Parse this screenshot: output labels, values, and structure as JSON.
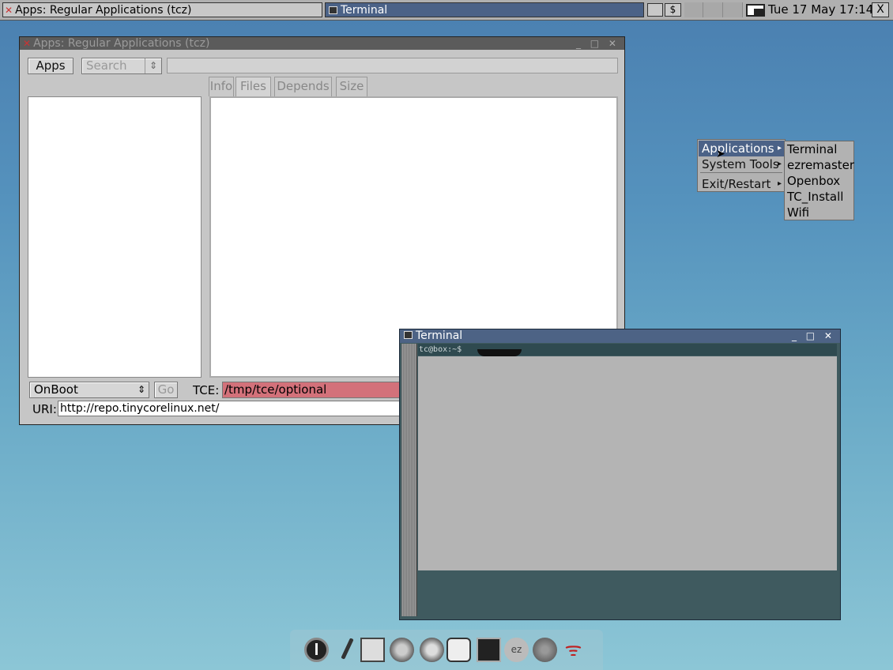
{
  "taskbar": {
    "apps_task": "Apps: Regular Applications (tcz)",
    "terminal_task": "Terminal",
    "tray_1": "",
    "tray_2": "$",
    "clock": "Tue 17 May 17:14",
    "close": "X"
  },
  "apps_window": {
    "title": "Apps: Regular Applications (tcz)",
    "controls": "_ □ ✕",
    "apps_button": "Apps",
    "search_select": "Search",
    "search_value": "",
    "tabs": [
      "Info",
      "Files",
      "Depends",
      "Size"
    ],
    "onboot_select": "OnBoot",
    "go_button": "Go",
    "tce_label": "TCE:",
    "tce_value": "/tmp/tce/optional",
    "uri_label": "URI:",
    "uri_value": "http://repo.tinycorelinux.net/"
  },
  "terminal_window": {
    "title": "Terminal",
    "controls": "_ □ ✕",
    "prompt": "tc@box:~$"
  },
  "menu": {
    "items": [
      {
        "label": "Applications"
      },
      {
        "label": "System Tools"
      },
      {
        "label": "Exit/Restart"
      }
    ],
    "submenu": [
      "Terminal",
      "ezremaster",
      "Openbox",
      "TC_Install",
      "Wifi"
    ]
  },
  "dock": {
    "icons": [
      "power-icon",
      "paintbrush-icon",
      "control-panel-icon",
      "apps-icon",
      "run-icon",
      "tce-load-icon",
      "terminal-icon",
      "ezremaster-icon",
      "cd-icon",
      "wifi-icon"
    ],
    "ezremaster_text": "ez"
  },
  "colors": {
    "active_title": "#4b6287",
    "tce_field": "#d3717a"
  }
}
